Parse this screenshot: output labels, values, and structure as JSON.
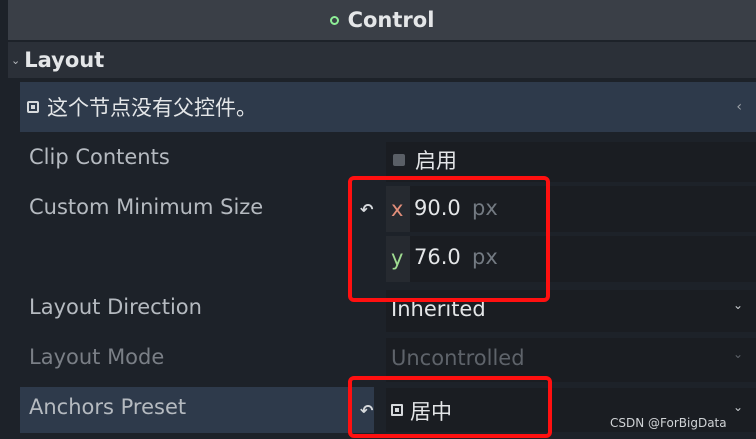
{
  "header": {
    "title": "Control",
    "dot_color": "#8eef97"
  },
  "section": {
    "title": "Layout",
    "chevron_icon": "chevron-down-icon"
  },
  "notice": {
    "text": "这个节点没有父控件。",
    "icon": "control-node-icon",
    "arrow_icon": "chevron-left-icon"
  },
  "properties": {
    "clip_contents": {
      "label": "Clip Contents",
      "value_label": "启用",
      "checked": false
    },
    "custom_min_size": {
      "label": "Custom Minimum Size",
      "revert_icon": "revert-icon",
      "x": {
        "axis": "x",
        "value": "90.0",
        "unit": "px"
      },
      "y": {
        "axis": "y",
        "value": "76.0",
        "unit": "px"
      }
    },
    "layout_direction": {
      "label": "Layout Direction",
      "value": "Inherited"
    },
    "layout_mode": {
      "label": "Layout Mode",
      "value": "Uncontrolled"
    },
    "anchors_preset": {
      "label": "Anchors Preset",
      "value": "居中",
      "revert_icon": "revert-icon",
      "icon": "anchor-center-icon"
    }
  },
  "revert_glyph": "↶",
  "dropdown_glyph": "⌄",
  "watermark": "CSDN @ForBigData",
  "colors": {
    "highlight": "#ff1010",
    "axis_x": "#e28e7a",
    "axis_y": "#9fdc91",
    "selected_row": "#2e3a4b"
  }
}
